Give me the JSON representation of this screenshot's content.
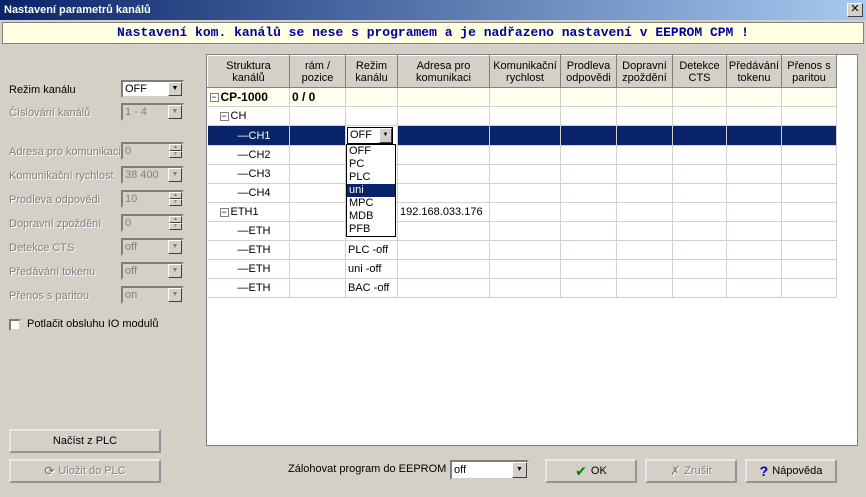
{
  "window": {
    "title": "Nastavení parametrů kanálů"
  },
  "banner": {
    "text": "Nastavení kom. kanálů se nese s programem a je nadřazeno nastavení v EEPROM CPM !"
  },
  "left": {
    "rezim_label": "Režim kanálu",
    "rezim_value": "OFF",
    "cislovani_label": "Číslování kanálů",
    "cislovani_value": "1 - 4",
    "adresa_label": "Adresa pro komunikaci",
    "adresa_value": "0",
    "rychlost_label": "Komunikační rychlost",
    "rychlost_value": "38 400",
    "prodleva_label": "Prodleva odpovědi",
    "prodleva_value": "10",
    "zpozdeni_label": "Dopravní zpoždění",
    "zpozdeni_value": "0",
    "cts_label": "Detekce CTS",
    "cts_value": "off",
    "token_label": "Předávání tokenu",
    "token_value": "off",
    "parita_label": "Přenos s paritou",
    "parita_value": "on",
    "checkbox_label": "Potlačit obsluhu IO modulů",
    "load_button": "Načíst z PLC",
    "save_button": "Uložit do PLC"
  },
  "table": {
    "headers": [
      "Struktura kanálů",
      "rám / pozice",
      "Režim kanálu",
      "Adresa pro komunikaci",
      "Komunikační rychlost",
      "Prodleva odpovědi",
      "Dopravní zpoždění",
      "Detekce CTS",
      "Předávání tokenu",
      "Přenos s paritou"
    ],
    "rows": [
      {
        "name": "CP-1000",
        "pos": "0 / 0",
        "mode": "",
        "addr": ""
      },
      {
        "name": "CH",
        "pos": "",
        "mode": "",
        "addr": ""
      },
      {
        "name": "CH1",
        "pos": "",
        "mode": "OFF",
        "addr": ""
      },
      {
        "name": "CH2",
        "pos": "",
        "mode": "",
        "addr": ""
      },
      {
        "name": "CH3",
        "pos": "",
        "mode": "",
        "addr": ""
      },
      {
        "name": "CH4",
        "pos": "",
        "mode": "",
        "addr": ""
      },
      {
        "name": "ETH1",
        "pos": "",
        "mode": "",
        "addr": "192.168.033.176"
      },
      {
        "name": "ETH",
        "pos": "",
        "mode": "",
        "addr": ""
      },
      {
        "name": "ETH",
        "pos": "",
        "mode": "PLC -off",
        "addr": ""
      },
      {
        "name": "ETH",
        "pos": "",
        "mode": "uni -off",
        "addr": ""
      },
      {
        "name": "ETH",
        "pos": "",
        "mode": "BAC -off",
        "addr": ""
      }
    ],
    "dropdown_options": [
      "OFF",
      "PC",
      "PLC",
      "uni",
      "MPC",
      "MDB",
      "PFB"
    ],
    "dropdown_highlighted": "uni"
  },
  "bottom": {
    "backup_label": "Zálohovat program do EEPROM",
    "backup_value": "off",
    "ok_button": "OK",
    "cancel_button": "Zrušit",
    "help_button": "Nápověda"
  }
}
